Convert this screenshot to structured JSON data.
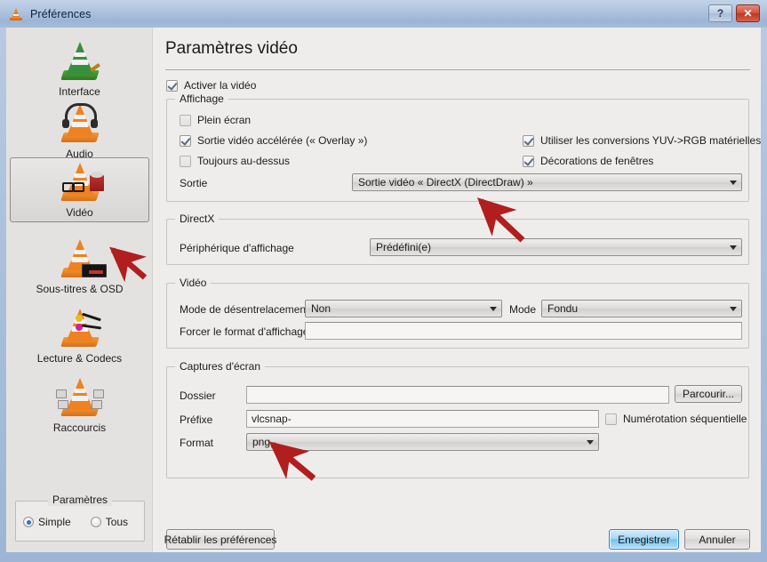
{
  "window": {
    "title": "Préférences",
    "icon": "vlc-cone-icon",
    "help_button": "?",
    "close_button": "✕"
  },
  "sidebar": {
    "items": [
      {
        "label": "Interface",
        "icon": "vlc-cone-interface-icon",
        "selected": false
      },
      {
        "label": "Audio",
        "icon": "vlc-cone-headphones-icon",
        "selected": false
      },
      {
        "label": "Vidéo",
        "icon": "vlc-cone-film-icon",
        "selected": true
      },
      {
        "label": "Sous-titres & OSD",
        "icon": "vlc-cone-subtitles-icon",
        "selected": false
      },
      {
        "label": "Lecture & Codecs",
        "icon": "vlc-cone-cables-icon",
        "selected": false
      },
      {
        "label": "Raccourcis",
        "icon": "vlc-cone-keys-icon",
        "selected": false
      }
    ],
    "settings_group": {
      "title": "Paramètres",
      "options": [
        {
          "label": "Simple",
          "selected": true
        },
        {
          "label": "Tous",
          "selected": false
        }
      ]
    }
  },
  "main": {
    "page_title": "Paramètres vidéo",
    "enable_video": {
      "label": "Activer la vidéo",
      "checked": true
    },
    "display_group": {
      "title": "Affichage",
      "checkboxes_left": [
        {
          "label": "Plein écran",
          "checked": false
        },
        {
          "label": "Sortie vidéo accélérée (« Overlay »)",
          "checked": true
        },
        {
          "label": "Toujours au-dessus",
          "checked": false
        }
      ],
      "checkboxes_right": [
        {
          "label": "Utiliser les conversions YUV->RGB matérielles",
          "checked": true
        },
        {
          "label": "Décorations de fenêtres",
          "checked": true
        }
      ],
      "output_label": "Sortie",
      "output_value": "Sortie vidéo « DirectX (DirectDraw) »"
    },
    "directx_group": {
      "title": "DirectX",
      "device_label": "Périphérique d'affichage",
      "device_value": "Prédéfini(e)"
    },
    "video_group": {
      "title": "Vidéo",
      "deinterlace_label": "Mode de désentrelacement",
      "deinterlace_value": "Non",
      "mode_label": "Mode",
      "mode_value": "Fondu",
      "aspect_label": "Forcer le format d'affichage",
      "aspect_value": ""
    },
    "snapshot_group": {
      "title": "Captures d'écran",
      "folder_label": "Dossier",
      "folder_value": "",
      "browse_button": "Parcourir...",
      "prefix_label": "Préfixe",
      "prefix_value": "vlcsnap-",
      "sequential_label": "Numérotation séquentielle",
      "sequential_checked": false,
      "format_label": "Format",
      "format_value": "png"
    }
  },
  "footer": {
    "reset_button": "Rétablir les préférences",
    "save_button": "Enregistrer",
    "cancel_button": "Annuler"
  },
  "annotations": {
    "color": "#b01e1e",
    "arrows": [
      {
        "target": "sidebar-item-video"
      },
      {
        "target": "output-combo"
      },
      {
        "target": "format-combo"
      }
    ]
  }
}
